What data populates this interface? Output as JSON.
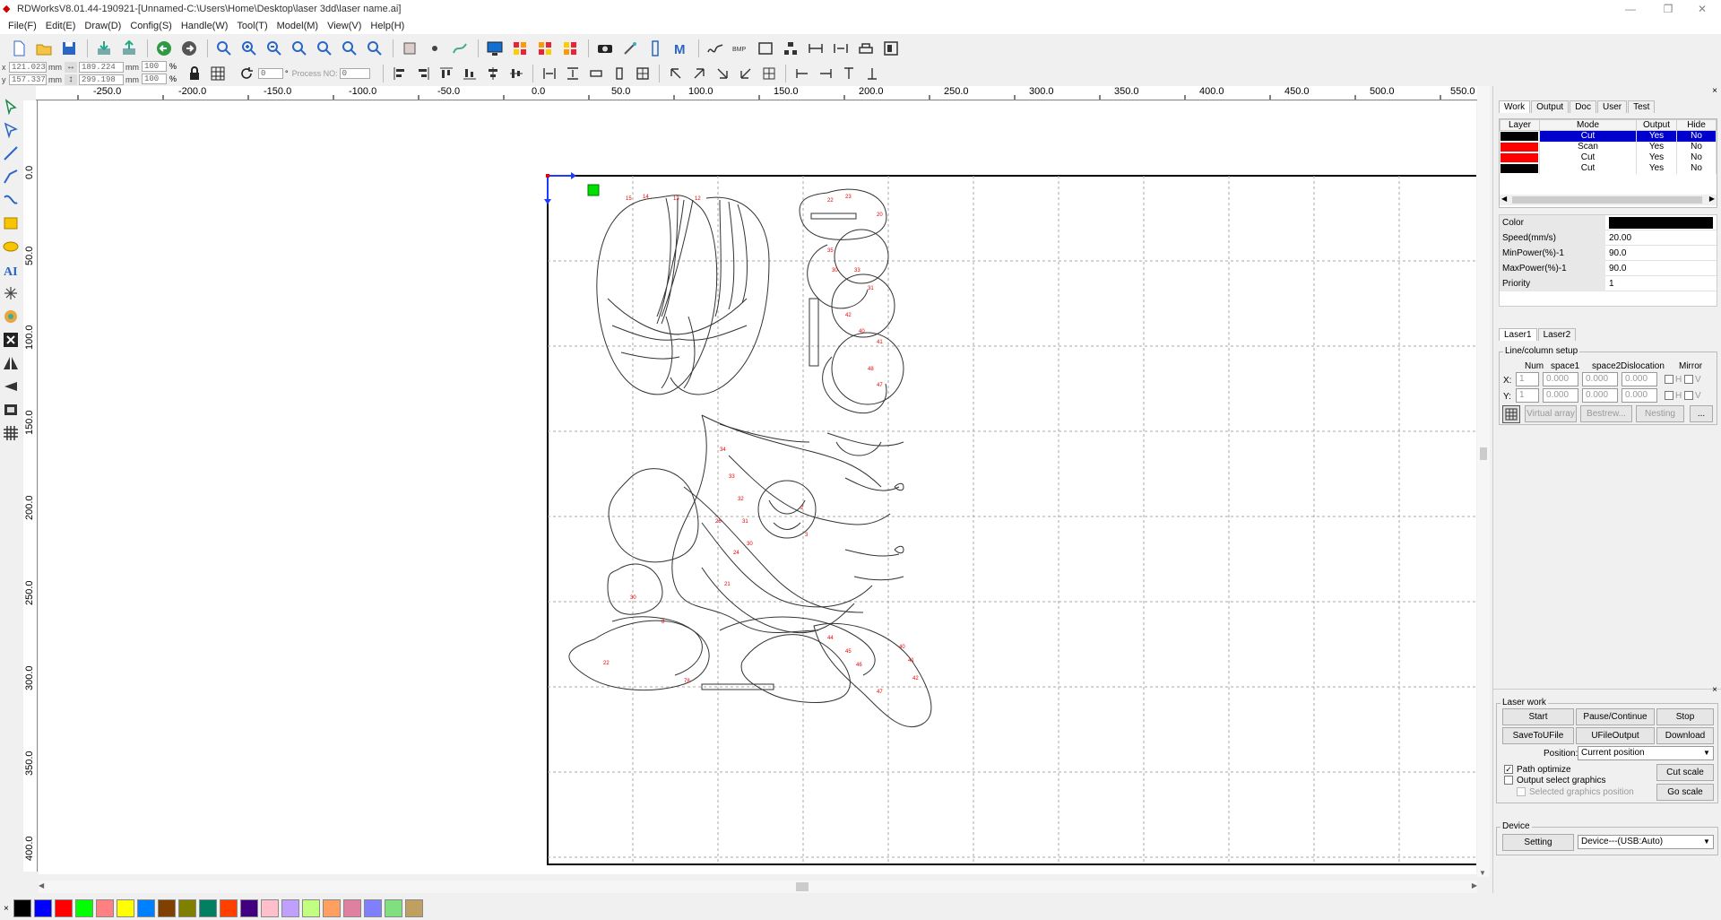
{
  "window": {
    "title": "RDWorksV8.01.44-190921-[Unnamed-C:\\Users\\Home\\Desktop\\laser 3dd\\laser name.ai]",
    "min_glyph": "—",
    "max_glyph": "❐",
    "close_glyph": "✕"
  },
  "menu": [
    "File(F)",
    "Edit(E)",
    "Draw(D)",
    "Config(S)",
    "Handle(W)",
    "Tool(T)",
    "Model(M)",
    "View(V)",
    "Help(H)"
  ],
  "coords": {
    "x_label": "x",
    "y_label": "y",
    "x_value": "121.023",
    "y_value": "157.337",
    "w_value": "189.224",
    "h_value": "299.198",
    "unit": "mm",
    "scale_x": "100",
    "scale_y": "100",
    "percent": "%",
    "angle": "0",
    "degree": "°",
    "process_label": "Process NO:",
    "process_value": "0"
  },
  "ruler": {
    "h_labels": [
      "-250.0",
      "-200.0",
      "-150.0",
      "-100.0",
      "-50.0",
      "0.0",
      "50.0",
      "100.0",
      "150.0",
      "200.0",
      "250.0",
      "300.0",
      "350.0",
      "400.0",
      "450.0",
      "500.0",
      "550.0"
    ],
    "v_labels": [
      "0.0",
      "50.0",
      "100.0",
      "150.0",
      "200.0",
      "250.0",
      "300.0",
      "350.0",
      "400.0"
    ]
  },
  "panel": {
    "tabs": [
      "Work",
      "Output",
      "Doc",
      "User",
      "Test"
    ],
    "layer_headers": [
      "Layer",
      "Mode",
      "Output",
      "Hide"
    ],
    "layers": [
      {
        "color": "#000000",
        "mode": "Cut",
        "output": "Yes",
        "hide": "No"
      },
      {
        "color": "#ff0000",
        "mode": "Scan",
        "output": "Yes",
        "hide": "No"
      },
      {
        "color": "#ff0000",
        "mode": "Cut",
        "output": "Yes",
        "hide": "No"
      },
      {
        "color": "#000000",
        "mode": "Cut",
        "output": "Yes",
        "hide": "No"
      }
    ],
    "props": [
      {
        "key": "Color",
        "value": ""
      },
      {
        "key": "Speed(mm/s)",
        "value": "20.00"
      },
      {
        "key": "MinPower(%)-1",
        "value": "90.0"
      },
      {
        "key": "MaxPower(%)-1",
        "value": "90.0"
      },
      {
        "key": "Priority",
        "value": "1"
      }
    ],
    "laser_tabs": [
      "Laser1",
      "Laser2"
    ],
    "array": {
      "title": "Line/column setup",
      "headers": [
        "Num",
        "space1",
        "space2",
        "Dislocation",
        "Mirror"
      ],
      "x_label": "X:",
      "y_label": "Y:",
      "num": "1",
      "space": "0.000",
      "h": "H",
      "v": "V",
      "btn_virtual": "Virtual array",
      "btn_bestrew": "Bestrew...",
      "btn_nesting": "Nesting",
      "btn_more": "..."
    },
    "laserwork": {
      "title": "Laser work",
      "start": "Start",
      "pause": "Pause/Continue",
      "stop": "Stop",
      "save": "SaveToUFile",
      "ufile": "UFileOutput",
      "download": "Download",
      "position_label": "Position:",
      "position_value": "Current position",
      "path_optimize": "Path optimize",
      "output_select": "Output select graphics",
      "selected_pos": "Selected graphics position",
      "cut_scale": "Cut scale",
      "go_scale": "Go scale"
    },
    "device": {
      "title": "Device",
      "setting": "Setting",
      "value": "Device---(USB:Auto)"
    }
  },
  "palette": {
    "close_glyph": "×",
    "colors": [
      "#000000",
      "#0000ff",
      "#ff0000",
      "#00ff00",
      "#ff8080",
      "#ffff00",
      "#0080ff",
      "#804000",
      "#808000",
      "#008060",
      "#ff4000",
      "#400080",
      "#ffc0cb",
      "#c0a0ff",
      "#c0ff80",
      "#ffa060",
      "#e080a0",
      "#8080ff",
      "#80e080",
      "#c0a060"
    ]
  }
}
